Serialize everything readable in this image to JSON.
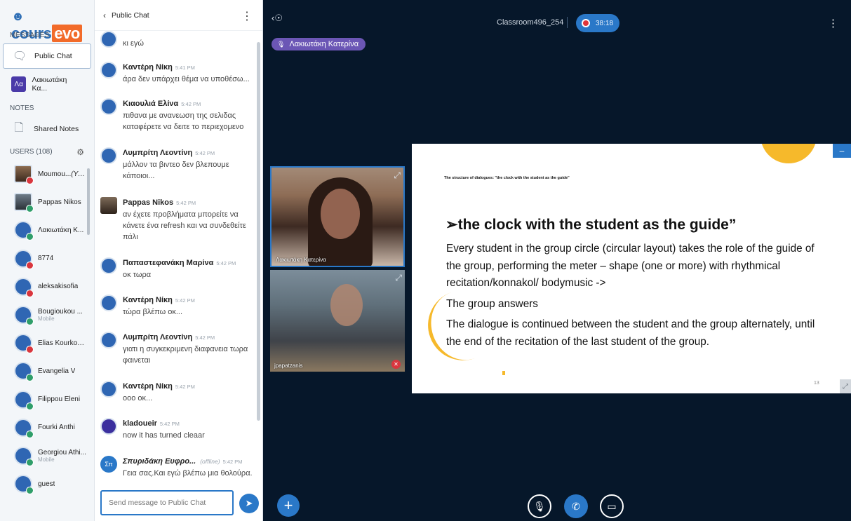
{
  "logo": {
    "prefix": "cours",
    "suffix": "evo"
  },
  "sidebar": {
    "messages_heading": "MESSAGES",
    "public_chat_label": "Public Chat",
    "private_chat": {
      "initials": "Λα",
      "label": "Λακιωτάκη Κα..."
    },
    "notes_heading": "NOTES",
    "shared_notes_label": "Shared Notes",
    "users_heading": "USERS (108)",
    "users": [
      {
        "name": "Moumou...",
        "suffix": "(You)",
        "status": "red",
        "sub": ""
      },
      {
        "name": "Pappas Nikos",
        "suffix": "",
        "status": "green",
        "sub": ""
      },
      {
        "name": "Λακιωτάκη Κ...",
        "suffix": "",
        "status": "green",
        "sub": ""
      },
      {
        "name": "8774",
        "suffix": "",
        "status": "red",
        "sub": ""
      },
      {
        "name": "aleksakisofia",
        "suffix": "",
        "status": "red",
        "sub": ""
      },
      {
        "name": "Bougioukou ...",
        "suffix": "",
        "status": "green",
        "sub": "Mobile"
      },
      {
        "name": "Elias Kourkou...",
        "suffix": "",
        "status": "red",
        "sub": ""
      },
      {
        "name": "Evangelia V",
        "suffix": "",
        "status": "green",
        "sub": ""
      },
      {
        "name": "Filippou Eleni",
        "suffix": "",
        "status": "green",
        "sub": ""
      },
      {
        "name": "Fourki Anthi",
        "suffix": "",
        "status": "green",
        "sub": ""
      },
      {
        "name": "Georgiou Athi...",
        "suffix": "",
        "status": "green",
        "sub": "Mobile"
      },
      {
        "name": "guest",
        "suffix": "",
        "status": "green",
        "sub": ""
      }
    ]
  },
  "chat": {
    "title": "Public Chat",
    "messages": [
      {
        "author": "",
        "time": "",
        "text": "κι εγώ",
        "avatar": "blue"
      },
      {
        "author": "Καντέρη Νίκη",
        "time": "5:41 PM",
        "text": "άρα δεν υπάρχει θέμα να υποθέσω...",
        "avatar": "blue"
      },
      {
        "author": "Κιαουλιά Ελίνα",
        "time": "5:42 PM",
        "text": "πιθανα με ανανεωση της σελιδας καταφέρετε να δειτε το περιεχομενο",
        "avatar": "blue"
      },
      {
        "author": "Λυμπρίτη Λεοντίνη",
        "time": "5:42 PM",
        "text": "μάλλον τα βιντεο δεν βλεπουμε κάποιοι...",
        "avatar": "blue"
      },
      {
        "author": "Pappas Nikos",
        "time": "5:42 PM",
        "text": "αν έχετε προβλήματα μπορείτε να κάνετε ένα refresh και να συνδεθείτε πάλι",
        "avatar": "photo"
      },
      {
        "author": "Παπαστεφανάκη Μαρίνα",
        "time": "5:42 PM",
        "text": "οκ τωρα",
        "avatar": "blue"
      },
      {
        "author": "Καντέρη Νίκη",
        "time": "5:42 PM",
        "text": "τώρα βλέπω οκ...",
        "avatar": "blue"
      },
      {
        "author": "Λυμπρίτη Λεοντίνη",
        "time": "5:42 PM",
        "text": "γιατι η συγκεκριμενη διαφανεια τωρα φαινεται",
        "avatar": "blue"
      },
      {
        "author": "Καντέρη Νίκη",
        "time": "5:42 PM",
        "text": "οοο οκ...",
        "avatar": "blue"
      },
      {
        "author": "kladoueir",
        "time": "5:42 PM",
        "text": "now it has turned cleaar",
        "avatar": "purple"
      },
      {
        "author": "Σπυριδάκη Ευφρο...",
        "time": "5:42 PM",
        "offline": "(offline)",
        "text": "Γεια σας.Και εγώ βλέπω μια θολούρα.",
        "avatar": "initials",
        "initials": "Σπ"
      }
    ],
    "input_placeholder": "Send message to Public Chat"
  },
  "meeting": {
    "room_name": "Classroom496_254",
    "recording_time": "38:18",
    "talking_indicator": "Λακιωτάκη Κατερίνα",
    "cameras": [
      {
        "label": "Λακιωτάκη Κατερίνα"
      },
      {
        "label": "jpapatzanis"
      }
    ],
    "slide": {
      "small_title": "The structure of dialogues: \"the clock with the student as the guide\"",
      "heading": "the clock with the student as the guide”",
      "bullets": [
        "Every student in the group circle (circular layout) takes the role of the guide of the group, performing the meter – shape (one or more) with rhythmical recitation/konnakol/ bodymusic ->",
        "The group answers",
        "The dialogue is continued between the student and the group alternately, until the end of the recitation of the last student of the group."
      ],
      "page_number": "13"
    }
  },
  "colors": {
    "accent": "#2a78c8",
    "brand_orange": "#f26b2a",
    "slide_accent": "#f6b92b",
    "meeting_bg": "#06172a"
  },
  "icons": [
    "back-icon",
    "kebab-icon",
    "chat-bubble-icon",
    "notes-icon",
    "gear-icon",
    "send-icon",
    "user-list-icon",
    "record-icon",
    "plus-icon",
    "mic-muted-icon",
    "phone-icon",
    "camera-off-icon",
    "fullscreen-icon",
    "minimize-icon"
  ]
}
